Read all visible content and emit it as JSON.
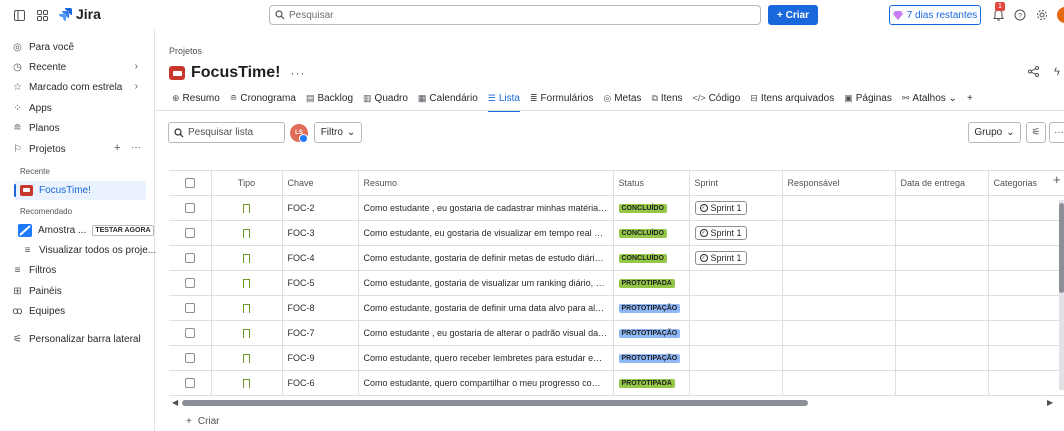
{
  "topbar": {
    "app_name": "Jira",
    "search_placeholder": "Pesquisar",
    "create_label": "+ Criar",
    "trial_label": "7 dias restantes",
    "notification_count": "1"
  },
  "sidebar": {
    "items": [
      {
        "label": "Para você",
        "icon": "user-circle-icon"
      },
      {
        "label": "Recente",
        "icon": "clock-icon"
      },
      {
        "label": "Marcado com estrela",
        "icon": "star-icon"
      },
      {
        "label": "Apps",
        "icon": "apps-icon"
      },
      {
        "label": "Planos",
        "icon": "plans-icon"
      },
      {
        "label": "Projetos",
        "icon": "rocket-icon"
      }
    ],
    "recent_heading": "Recente",
    "active_project": "FocusTime!",
    "recommended_heading": "Recomendado",
    "sample_label": "Amostra ...",
    "sample_badge": "TESTAR AGORA",
    "view_all": "Visualizar todos os proje...",
    "filters": "Filtros",
    "dashboards": "Painéis",
    "teams": "Equipes",
    "customize": "Personalizar barra lateral"
  },
  "main": {
    "breadcrumb": "Projetos",
    "project_title": "FocusTime!",
    "tabs": [
      {
        "label": "Resumo",
        "icon": "⊕"
      },
      {
        "label": "Cronograma",
        "icon": "≘"
      },
      {
        "label": "Backlog",
        "icon": "▤"
      },
      {
        "label": "Quadro",
        "icon": "▥"
      },
      {
        "label": "Calendário",
        "icon": "▦"
      },
      {
        "label": "Lista",
        "icon": "☰",
        "active": true
      },
      {
        "label": "Formulários",
        "icon": "≣"
      },
      {
        "label": "Metas",
        "icon": "◎"
      },
      {
        "label": "Itens",
        "icon": "⧉"
      },
      {
        "label": "Código",
        "icon": "</>"
      },
      {
        "label": "Itens arquivados",
        "icon": "⊟"
      },
      {
        "label": "Páginas",
        "icon": "▣"
      },
      {
        "label": "Atalhos ⌄",
        "icon": "⚯"
      },
      {
        "label": "+",
        "icon": ""
      }
    ],
    "search_list_placeholder": "Pesquisar lista",
    "avatar_initials": "LS",
    "filter_label": "Filtro",
    "group_label": "Grupo"
  },
  "table": {
    "headers": [
      "",
      "Tipo",
      "Chave",
      "Resumo",
      "Status",
      "Sprint",
      "Responsável",
      "Data de entrega",
      "Categorias"
    ],
    "rows": [
      {
        "key": "FOC-2",
        "summary": "Como estudante , eu gostaria de cadastrar minhas matérias ...",
        "status": "CONCLUÍDO",
        "status_color": "green",
        "sprint": "Sprint 1"
      },
      {
        "key": "FOC-3",
        "summary": "Como estudante, eu gostaria de visualizar em tempo real a q...",
        "status": "CONCLUÍDO",
        "status_color": "green",
        "sprint": "Sprint 1"
      },
      {
        "key": "FOC-4",
        "summary": "Como estudante, gostaria de definir metas de estudo diárias,...",
        "status": "CONCLUÍDO",
        "status_color": "green",
        "sprint": "Sprint 1"
      },
      {
        "key": "FOC-5",
        "summary": "Como estudante, gostaria de visualizar um ranking diário, pa...",
        "status": "PROTOTIPADA",
        "status_color": "green",
        "sprint": ""
      },
      {
        "key": "FOC-8",
        "summary": "Como estudante, gostaria de definir uma data alvo para alca...",
        "status": "PROTOTIPAÇÃO",
        "status_color": "blue",
        "sprint": ""
      },
      {
        "key": "FOC-7",
        "summary": "Como estudante , eu gostaria de alterar o padrão visual da ...",
        "status": "PROTOTIPAÇÃO",
        "status_color": "blue",
        "sprint": ""
      },
      {
        "key": "FOC-9",
        "summary": "Como estudante, quero receber lembretes para estudar em ...",
        "status": "PROTOTIPAÇÃO",
        "status_color": "blue",
        "sprint": ""
      },
      {
        "key": "FOC-6",
        "summary": "Como estudante, quero compartilhar o meu progresso com ...",
        "status": "PROTOTIPADA",
        "status_color": "green",
        "sprint": ""
      }
    ],
    "create_label": "Criar"
  },
  "colors": {
    "accent": "#1868db",
    "done_green": "#94c748",
    "prototyping_blue": "#8fb8f6",
    "project_red": "#c9372c"
  }
}
